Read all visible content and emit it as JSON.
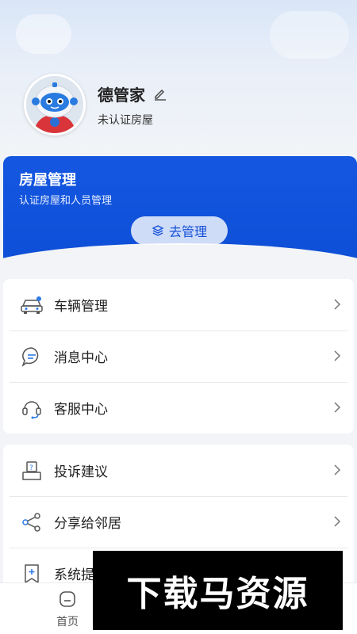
{
  "profile": {
    "name": "德管家",
    "status": "未认证房屋"
  },
  "house_card": {
    "title": "房屋管理",
    "subtitle": "认证房屋和人员管理",
    "button_label": "去管理"
  },
  "menu_group_1": [
    {
      "label": "车辆管理",
      "icon": "car-icon"
    },
    {
      "label": "消息中心",
      "icon": "message-icon"
    },
    {
      "label": "客服中心",
      "icon": "headset-icon"
    }
  ],
  "menu_group_2": [
    {
      "label": "投诉建议",
      "icon": "complaint-icon"
    },
    {
      "label": "分享给邻居",
      "icon": "share-icon"
    },
    {
      "label": "系统提",
      "icon": "system-icon"
    }
  ],
  "tabbar": {
    "home_label": "首页"
  },
  "watermark": {
    "text": "下载马资源"
  },
  "colors": {
    "primary_blue": "#1052dc",
    "icon_blue": "#2f7be6",
    "background": "#f2f4f7"
  }
}
